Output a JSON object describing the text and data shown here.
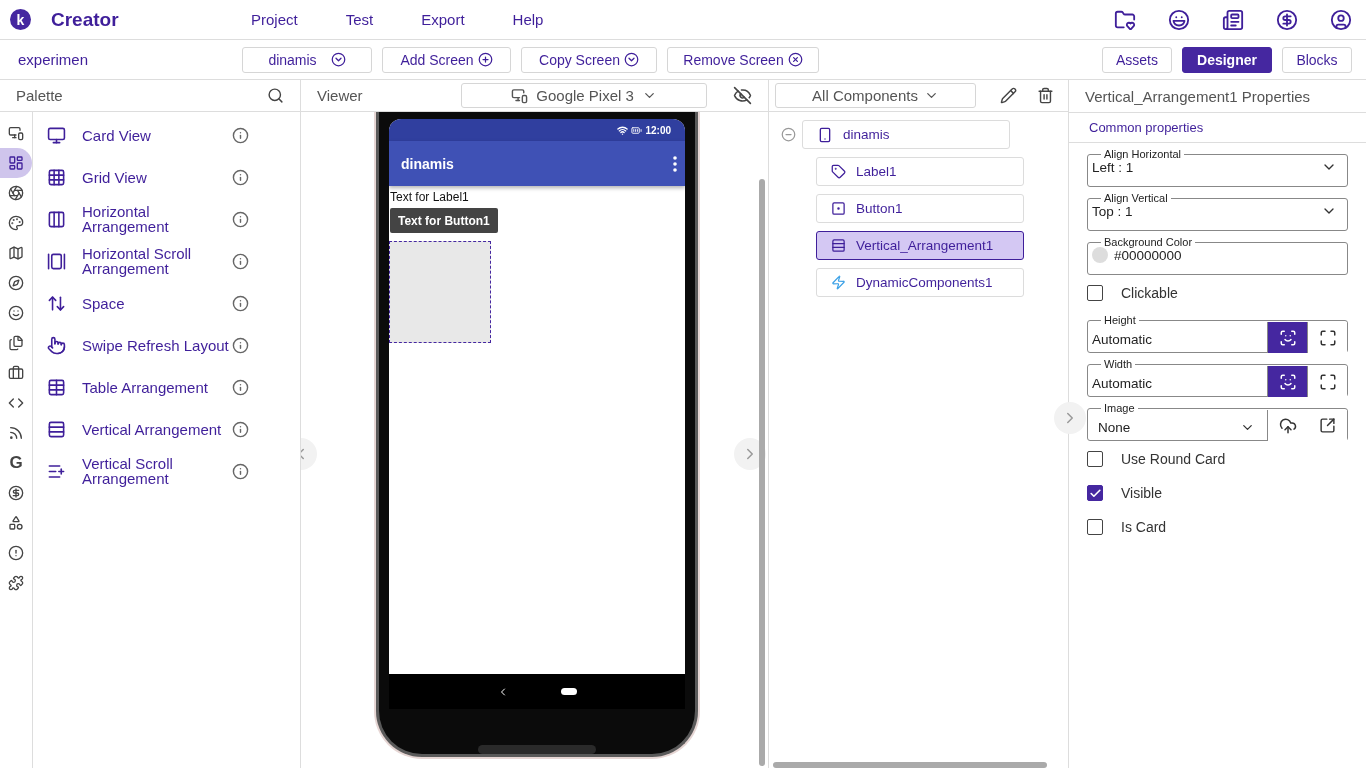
{
  "header": {
    "logo": "k",
    "brand": "Creator",
    "menu": [
      "Project",
      "Test",
      "Export",
      "Help"
    ]
  },
  "toolbar": {
    "project": "experimen",
    "screen_select": "dinamis",
    "buttons": [
      "Add Screen",
      "Copy Screen",
      "Remove Screen"
    ],
    "tabs": [
      {
        "label": "Assets",
        "selected": false
      },
      {
        "label": "Designer",
        "selected": true
      },
      {
        "label": "Blocks",
        "selected": false
      }
    ]
  },
  "palette": {
    "title": "Palette",
    "rail": [
      {
        "selected": false
      },
      {
        "selected": true
      },
      {
        "selected": false
      },
      {
        "selected": false
      },
      {
        "selected": false
      },
      {
        "selected": false
      },
      {
        "selected": false
      },
      {
        "selected": false
      },
      {
        "selected": false
      },
      {
        "selected": false
      },
      {
        "selected": false
      },
      {
        "selected": false,
        "glyph": "G"
      },
      {
        "selected": false
      },
      {
        "selected": false
      },
      {
        "selected": false
      },
      {
        "selected": false
      }
    ],
    "items": [
      "Card View",
      "Grid View",
      "Horizontal Arrangement",
      "Horizontal Scroll Arrangement",
      "Space",
      "Swipe Refresh Layout",
      "Table Arrangement",
      "Vertical Arrangement",
      "Vertical Scroll Arrangement"
    ]
  },
  "viewer": {
    "title": "Viewer",
    "device": "Google Pixel 3",
    "phone": {
      "time": "12:00",
      "app_title": "dinamis",
      "label": "Text for Label1",
      "button": "Text for Button1",
      "arrangement_selected": true
    }
  },
  "components": {
    "filter": "All Components",
    "tree": {
      "name": "dinamis",
      "expanded": true,
      "selected": false,
      "children": [
        {
          "name": "Label1",
          "selected": false
        },
        {
          "name": "Button1",
          "selected": false
        },
        {
          "name": "Vertical_Arrangement1",
          "selected": true
        },
        {
          "name": "DynamicComponents1",
          "selected": false
        }
      ]
    }
  },
  "properties": {
    "title": "Vertical_Arrangement1 Properties",
    "section": "Common properties",
    "fields": [
      {
        "kind": "select",
        "label": "Align Horizontal",
        "value": "Left : 1"
      },
      {
        "kind": "select",
        "label": "Align Vertical",
        "value": "Top : 1"
      },
      {
        "kind": "color",
        "label": "Background Color",
        "value": "#00000000",
        "color": "#dddddd"
      },
      {
        "kind": "checkbox",
        "label": "Clickable",
        "checked": false
      },
      {
        "kind": "size",
        "label": "Height",
        "value": "Automatic",
        "modes": [
          {
            "selected": true
          },
          {
            "selected": false
          }
        ]
      },
      {
        "kind": "size",
        "label": "Width",
        "value": "Automatic",
        "modes": [
          {
            "selected": true
          },
          {
            "selected": false
          }
        ]
      },
      {
        "kind": "image",
        "label": "Image",
        "value": "None"
      },
      {
        "kind": "checkbox",
        "label": "Use Round Card",
        "checked": false
      },
      {
        "kind": "checkbox",
        "label": "Visible",
        "checked": true
      },
      {
        "kind": "checkbox",
        "label": "Is Card",
        "checked": false
      }
    ]
  }
}
